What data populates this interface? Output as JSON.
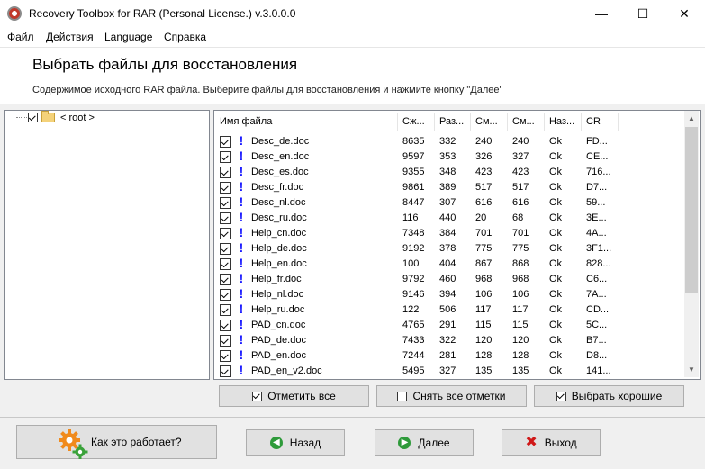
{
  "window": {
    "title": "Recovery Toolbox for RAR (Personal License.) v.3.0.0.0",
    "min_glyph": "—",
    "max_glyph": "☐",
    "close_glyph": "✕"
  },
  "menu": [
    "Файл",
    "Действия",
    "Language",
    "Справка"
  ],
  "header": {
    "title": "Выбрать файлы для восстановления",
    "subtitle": "Содержимое исходного RAR файла. Выберите файлы для восстановления и нажмите кнопку \"Далее\""
  },
  "tree": {
    "root_label": "< root >"
  },
  "columns": [
    "Имя файла",
    "Сж...",
    "Раз...",
    "См...",
    "См...",
    "Наз...",
    "CR"
  ],
  "rows": [
    [
      "Desc_de.doc",
      "8635",
      "332",
      "240",
      "240",
      "Ok",
      "FD..."
    ],
    [
      "Desc_en.doc",
      "9597",
      "353",
      "326",
      "327",
      "Ok",
      "CE..."
    ],
    [
      "Desc_es.doc",
      "9355",
      "348",
      "423",
      "423",
      "Ok",
      "716..."
    ],
    [
      "Desc_fr.doc",
      "9861",
      "389",
      "517",
      "517",
      "Ok",
      "D7..."
    ],
    [
      "Desc_nl.doc",
      "8447",
      "307",
      "616",
      "616",
      "Ok",
      "59..."
    ],
    [
      "Desc_ru.doc",
      "116",
      "440",
      "20",
      "68",
      "Ok",
      "3E..."
    ],
    [
      "Help_cn.doc",
      "7348",
      "384",
      "701",
      "701",
      "Ok",
      "4A..."
    ],
    [
      "Help_de.doc",
      "9192",
      "378",
      "775",
      "775",
      "Ok",
      "3F1..."
    ],
    [
      "Help_en.doc",
      "100",
      "404",
      "867",
      "868",
      "Ok",
      "828..."
    ],
    [
      "Help_fr.doc",
      "9792",
      "460",
      "968",
      "968",
      "Ok",
      "C6..."
    ],
    [
      "Help_nl.doc",
      "9146",
      "394",
      "106",
      "106",
      "Ok",
      "7A..."
    ],
    [
      "Help_ru.doc",
      "122",
      "506",
      "117",
      "117",
      "Ok",
      "CD..."
    ],
    [
      "PAD_cn.doc",
      "4765",
      "291",
      "115",
      "115",
      "Ok",
      "5C..."
    ],
    [
      "PAD_de.doc",
      "7433",
      "322",
      "120",
      "120",
      "Ok",
      "B7..."
    ],
    [
      "PAD_en.doc",
      "7244",
      "281",
      "128",
      "128",
      "Ok",
      "D8..."
    ],
    [
      "PAD_en_v2.doc",
      "5495",
      "327",
      "135",
      "135",
      "Ok",
      "141..."
    ]
  ],
  "row_mark": "!",
  "scroll": {
    "up": "▲",
    "down": "▼"
  },
  "actions": {
    "check_all": "Отметить все",
    "uncheck_all": "Снять все отметки",
    "select_good": "Выбрать хорошие"
  },
  "footer": {
    "how_it_works": "Как это работает?",
    "back": "Назад",
    "next": "Далее",
    "exit": "Выход",
    "back_glyph": "◀",
    "next_glyph": "▶",
    "exit_glyph": "✖"
  },
  "colors": {
    "accent_blue": "#1a1aff",
    "ok_green": "#2e9a3a",
    "exit_red": "#d01818"
  }
}
